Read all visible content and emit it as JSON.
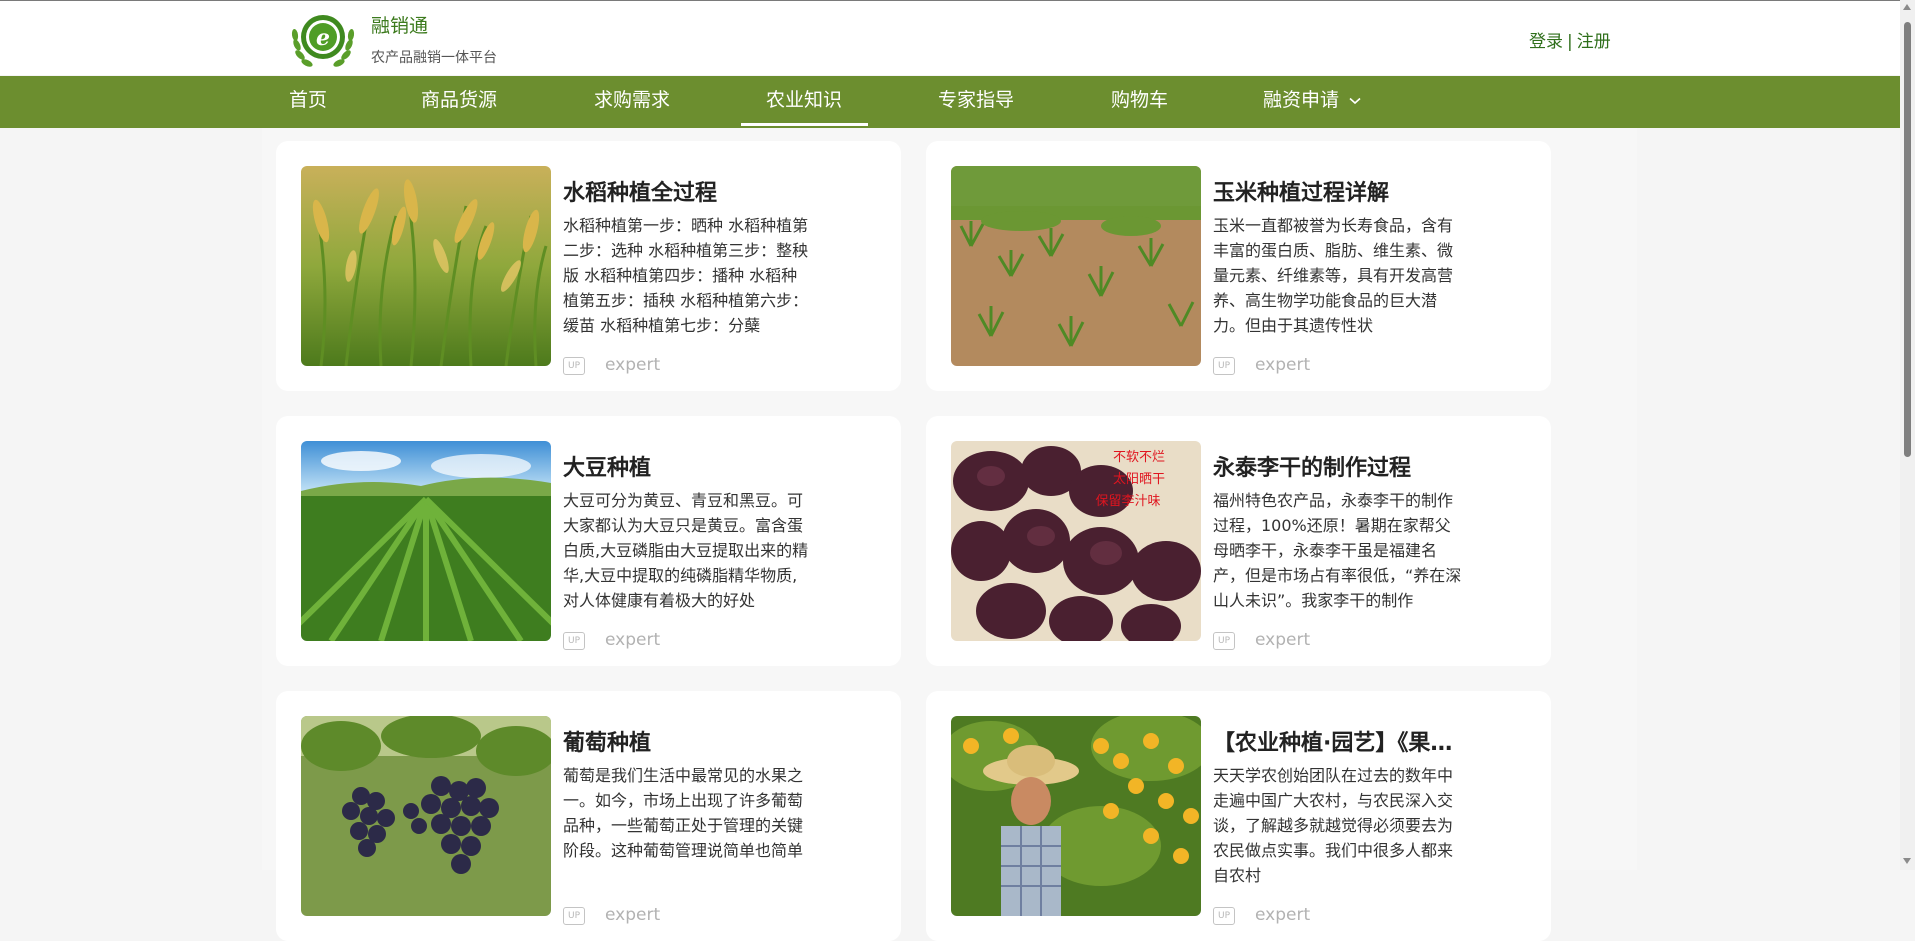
{
  "header": {
    "brand_name": "融销通",
    "tagline": "农产品融销一体平台",
    "login_label": "登录",
    "separator": "|",
    "register_label": "注册",
    "brand_color": "#3c7a1d"
  },
  "nav": {
    "items": [
      {
        "label": "首页"
      },
      {
        "label": "商品货源"
      },
      {
        "label": "求购需求"
      },
      {
        "label": "农业知识",
        "active": true
      },
      {
        "label": "专家指导"
      },
      {
        "label": "购物车"
      },
      {
        "label": "融资申请",
        "has_dropdown": true
      }
    ],
    "background_color": "#6c8e2f"
  },
  "articles": [
    {
      "title": "水稻种植全过程",
      "description": "水稻种植第一步：晒种 水稻种植第二步：选种 水稻种植第三步：整秧版 水稻种植第四步：播种 水稻种植第五步：插秧 水稻种植第六步：缓苗 水稻种植第七步：分蘖",
      "badge": "UP",
      "author": "expert",
      "image": "rice-field"
    },
    {
      "title": "玉米种植过程详解",
      "description": "玉米一直都被誉为长寿食品，含有丰富的蛋白质、脂肪、维生素、微量元素、纤维素等，具有开发高营养、高生物学功能食品的巨大潜力。但由于其遗传性状",
      "badge": "UP",
      "author": "expert",
      "image": "corn-field"
    },
    {
      "title": "大豆种植",
      "description": "大豆可分为黄豆、青豆和黑豆。可大家都认为大豆只是黄豆。富含蛋白质,大豆磷脂由大豆提取出来的精华,大豆中提取的纯磷脂精华物质,对人体健康有着极大的好处",
      "badge": "UP",
      "author": "expert",
      "image": "soybean-field"
    },
    {
      "title": "永泰李干的制作过程",
      "description": "福州特色农产品，永泰李干的制作过程，100%还原！暑期在家帮父母晒李干，永泰李干虽是福建名产，但是市场占有率很低，“养在深山人未识”。我家李干的制作",
      "badge": "UP",
      "author": "expert",
      "image": "dried-plums",
      "image_caption": [
        "不软不烂",
        "太阳晒干",
        "保留李汁味"
      ]
    },
    {
      "title": "葡萄种植",
      "description": "葡萄是我们生活中最常见的水果之一。如今，市场上出现了许多葡萄品种，一些葡萄正处于管理的关键阶段。这种葡萄管理说简单也简单",
      "badge": "UP",
      "author": "expert",
      "image": "grapes"
    },
    {
      "title": "【农业种植·园艺】《果树种植》",
      "description": "天天学农创始团队在过去的数年中走遍中国广大农村，与农民深入交谈，了解越多就越觉得必须要去为农民做点实事。我们中很多人都来自农村",
      "badge": "UP",
      "author": "expert",
      "image": "orange-orchard"
    }
  ]
}
